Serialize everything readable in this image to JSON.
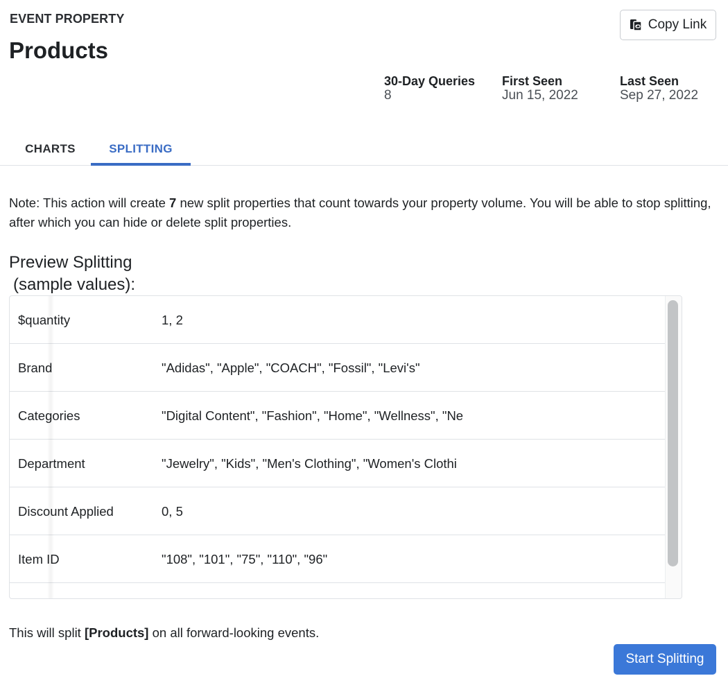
{
  "header": {
    "eyebrow": "EVENT PROPERTY",
    "title": "Products",
    "copy_link_label": "Copy Link",
    "copy_link_icon": "copy-link-icon"
  },
  "stats": {
    "queries": {
      "label": "30-Day Queries",
      "value": "8"
    },
    "first_seen": {
      "label": "First Seen",
      "value": "Jun 15, 2022"
    },
    "last_seen": {
      "label": "Last Seen",
      "value": "Sep 27, 2022"
    }
  },
  "tabs": [
    {
      "label": "CHARTS",
      "active": false
    },
    {
      "label": "SPLITTING",
      "active": true
    }
  ],
  "note": {
    "prefix": "Note: This action will create ",
    "count": "7",
    "suffix": " new split properties that count towards your property volume. You will be able to stop splitting, after which you can hide or delete split properties."
  },
  "preview": {
    "title_line1": "Preview Splitting",
    "title_line2": "(sample values):",
    "rows": [
      {
        "key": "$quantity",
        "value": "1, 2"
      },
      {
        "key": "Brand",
        "value": "\"Adidas\", \"Apple\", \"COACH\", \"Fossil\", \"Levi's\""
      },
      {
        "key": "Categories",
        "value": "\"Digital Content\", \"Fashion\", \"Home\", \"Wellness\", \"Ne"
      },
      {
        "key": "Department",
        "value": "\"Jewelry\", \"Kids\", \"Men's Clothing\", \"Women's Clothi"
      },
      {
        "key": "Discount Applied",
        "value": "0, 5"
      },
      {
        "key": "Item ID",
        "value": "\"108\", \"101\", \"75\", \"110\", \"96\""
      },
      {
        "key": "",
        "value": ""
      }
    ]
  },
  "footer": {
    "prefix": "This will split ",
    "property": "[Products]",
    "suffix": " on all forward-looking events.",
    "start_label": "Start Splitting"
  },
  "colors": {
    "accent": "#3a6cc4",
    "button": "#3b78d8"
  }
}
